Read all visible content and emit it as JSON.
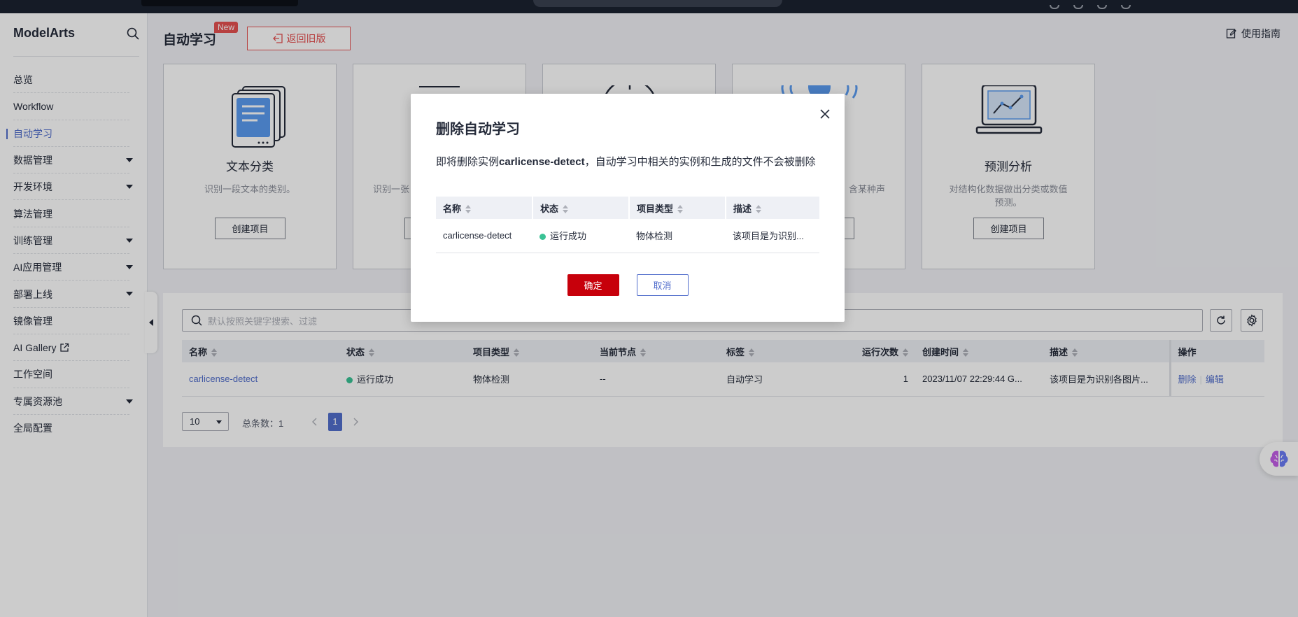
{
  "sidebar": {
    "title": "ModelArts",
    "items": [
      {
        "label": "总览",
        "expandable": false
      },
      {
        "label": "Workflow",
        "expandable": false
      },
      {
        "label": "自动学习",
        "expandable": false,
        "active": true
      },
      {
        "label": "数据管理",
        "expandable": true
      },
      {
        "label": "开发环境",
        "expandable": true
      },
      {
        "label": "算法管理",
        "expandable": false
      },
      {
        "label": "训练管理",
        "expandable": true
      },
      {
        "label": "AI应用管理",
        "expandable": true
      },
      {
        "label": "部署上线",
        "expandable": true
      },
      {
        "label": "镜像管理",
        "expandable": false
      },
      {
        "label": "AI Gallery",
        "expandable": false,
        "external": true
      },
      {
        "label": "工作空间",
        "expandable": false
      },
      {
        "label": "专属资源池",
        "expandable": true
      },
      {
        "label": "全局配置",
        "expandable": false
      }
    ]
  },
  "header": {
    "title": "自动学习",
    "badge": "New",
    "back_button": "返回旧版",
    "guide": "使用指南"
  },
  "cards": [
    {
      "title": "文本分类",
      "desc": "识别一段文本的类别。",
      "button": "创建项目",
      "icon": "document-stack-icon"
    },
    {
      "title": "",
      "desc": "识别一张",
      "button": "",
      "icon": "image-classification-icon"
    },
    {
      "title": "",
      "desc": "",
      "button": "",
      "icon": "target-icon"
    },
    {
      "title": "",
      "desc": "含某种声",
      "button": "",
      "icon": "sound-wave-icon"
    },
    {
      "title": "预测分析",
      "desc": "对结构化数据做出分类或数值预测。",
      "button": "创建项目",
      "icon": "laptop-chart-icon"
    }
  ],
  "list": {
    "search_placeholder": "默认按照关键字搜索、过滤",
    "columns": [
      "名称",
      "状态",
      "项目类型",
      "当前节点",
      "标签",
      "运行次数",
      "创建时间",
      "描述",
      "操作"
    ],
    "rows": [
      {
        "name": "carlicense-detect",
        "status": "运行成功",
        "type": "物体检测",
        "node": "--",
        "tag": "自动学习",
        "runs": "1",
        "created": "2023/11/07 22:29:44 G...",
        "desc": "该项目是为识别各图片...",
        "action_delete": "删除",
        "action_edit": "编辑"
      }
    ],
    "page_size": "10",
    "total": "总条数：1",
    "current_page": "1"
  },
  "modal": {
    "title": "删除自动学习",
    "msg_prefix": "即将删除实例",
    "msg_name": "carlicense-detect",
    "msg_suffix": "，自动学习中相关的实例和生成的文件不会被删除",
    "columns": [
      "名称",
      "状态",
      "项目类型",
      "描述"
    ],
    "row": {
      "name": "carlicense-detect",
      "status": "运行成功",
      "type": "物体检测",
      "desc": "该项目是为识别..."
    },
    "ok": "确定",
    "cancel": "取消"
  },
  "colors": {
    "accent": "#526ecc",
    "danger": "#c7000b",
    "success": "#3ac295",
    "badge": "#e55050"
  }
}
